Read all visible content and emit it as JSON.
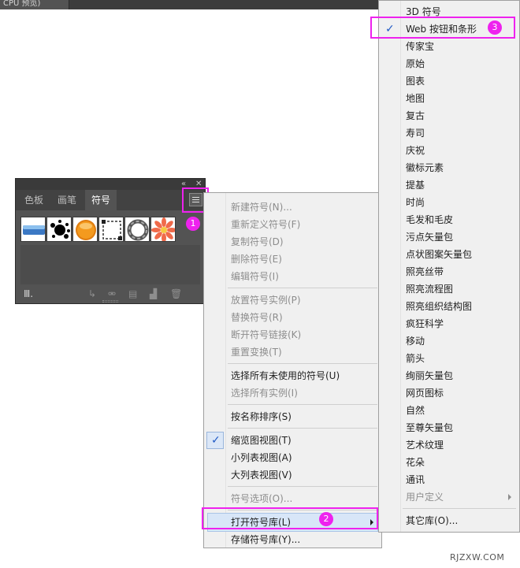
{
  "doc_tab": "CPU 预览)",
  "panel": {
    "header_controls": {
      "collapse": "«",
      "close": "✕"
    },
    "tabs": [
      "色板",
      "画笔",
      "符号"
    ],
    "active_tab": "符号",
    "swatch_icons": [
      "web-bar-symbol",
      "ink-splash-symbol",
      "orange-button-symbol",
      "frame-symbol",
      "ribbon-ring-symbol",
      "flower-symbol"
    ],
    "footer_icons": [
      "symbol-library-icon",
      "place-symbol-icon",
      "break-link-icon",
      "symbol-options-icon",
      "new-symbol-icon",
      "delete-icon"
    ]
  },
  "markers": [
    "1",
    "2",
    "3"
  ],
  "panel_menu": {
    "items": [
      {
        "label": "新建符号(N)...",
        "enabled": false
      },
      {
        "label": "重新定义符号(F)",
        "enabled": false
      },
      {
        "label": "复制符号(D)",
        "enabled": false
      },
      {
        "label": "删除符号(E)",
        "enabled": false
      },
      {
        "label": "编辑符号(I)",
        "enabled": false
      },
      {
        "label": "放置符号实例(P)",
        "enabled": false
      },
      {
        "label": "替换符号(R)",
        "enabled": false
      },
      {
        "label": "断开符号链接(K)",
        "enabled": false
      },
      {
        "label": "重置变换(T)",
        "enabled": false
      },
      {
        "label": "选择所有未使用的符号(U)",
        "enabled": true
      },
      {
        "label": "选择所有实例(I)",
        "enabled": false
      },
      {
        "label": "按名称排序(S)",
        "enabled": true
      },
      {
        "label": "缩览图视图(T)",
        "enabled": true,
        "checked": true
      },
      {
        "label": "小列表视图(A)",
        "enabled": true
      },
      {
        "label": "大列表视图(V)",
        "enabled": true
      },
      {
        "label": "符号选项(O)...",
        "enabled": false
      },
      {
        "label": "打开符号库(L)",
        "enabled": true,
        "submenu": true
      },
      {
        "label": "存储符号库(Y)...",
        "enabled": true
      }
    ]
  },
  "library_menu": {
    "items": [
      {
        "label": "3D 符号"
      },
      {
        "label": "Web 按钮和条形",
        "checked": true
      },
      {
        "label": "传家宝"
      },
      {
        "label": "原始"
      },
      {
        "label": "图表"
      },
      {
        "label": "地图"
      },
      {
        "label": "复古"
      },
      {
        "label": "寿司"
      },
      {
        "label": "庆祝"
      },
      {
        "label": "徽标元素"
      },
      {
        "label": "提基"
      },
      {
        "label": "时尚"
      },
      {
        "label": "毛发和毛皮"
      },
      {
        "label": "污点矢量包"
      },
      {
        "label": "点状图案矢量包"
      },
      {
        "label": "照亮丝带"
      },
      {
        "label": "照亮流程图"
      },
      {
        "label": "照亮组织结构图"
      },
      {
        "label": "疯狂科学"
      },
      {
        "label": "移动"
      },
      {
        "label": "箭头"
      },
      {
        "label": "绚丽矢量包"
      },
      {
        "label": "网页图标"
      },
      {
        "label": "自然"
      },
      {
        "label": "至尊矢量包"
      },
      {
        "label": "艺术纹理"
      },
      {
        "label": "花朵"
      },
      {
        "label": "通讯"
      },
      {
        "label": "用户定义",
        "enabled": false,
        "submenu": true
      },
      {
        "label": "其它库(O)..."
      }
    ]
  },
  "colors": {
    "highlight": "#ee22ee",
    "check": "#1f59c5",
    "panel_bg": "#535353"
  },
  "watermark": "RJZXW.COM"
}
